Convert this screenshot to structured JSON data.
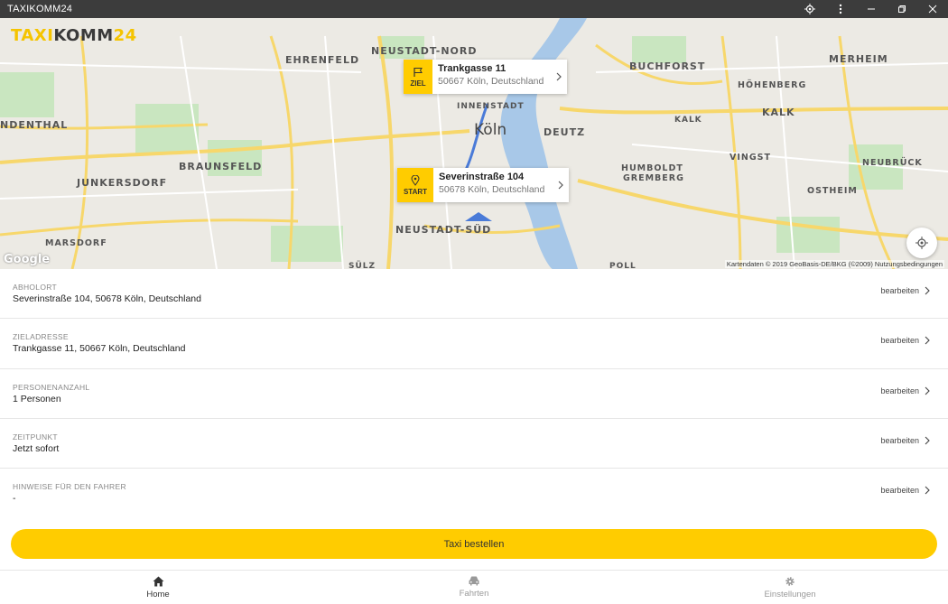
{
  "window": {
    "title": "TAXIKOMM24"
  },
  "logo": {
    "part1": "TAXI",
    "part2": "KOMM",
    "part3": "24"
  },
  "map": {
    "districts": [
      {
        "key": "neustadt_nord",
        "text": "NEUSTADT-NORD"
      },
      {
        "key": "ehrenfeld",
        "text": "EHRENFELD"
      },
      {
        "key": "buchforst",
        "text": "BUCHFORST"
      },
      {
        "key": "merheim",
        "text": "MERHEIM"
      },
      {
        "key": "hoehenberg",
        "text": "HÖHENBERG"
      },
      {
        "key": "kalk_small",
        "text": "KALK"
      },
      {
        "key": "kalk",
        "text": "KALK"
      },
      {
        "key": "innenstadt",
        "text": "INNENSTADT"
      },
      {
        "key": "deutz",
        "text": "DEUTZ"
      },
      {
        "key": "ndenthal",
        "text": "NDENTHAL"
      },
      {
        "key": "braunsfeld",
        "text": "BRAUNSFELD"
      },
      {
        "key": "junkersdorf",
        "text": "JUNKERSDORF"
      },
      {
        "key": "vingst",
        "text": "VINGST"
      },
      {
        "key": "neubrueck",
        "text": "NEUBRÜCK"
      },
      {
        "key": "humboldt",
        "text": "HUMBOLDT"
      },
      {
        "key": "gremberg",
        "text": "GREMBERG"
      },
      {
        "key": "ostheim",
        "text": "OSTHEIM"
      },
      {
        "key": "neustadt_sued",
        "text": "NEUSTADT-SÜD"
      },
      {
        "key": "marsdorf",
        "text": "MARSDORF"
      },
      {
        "key": "suelz",
        "text": "SÜLZ"
      },
      {
        "key": "poll",
        "text": "POLL"
      }
    ],
    "city": "Köln",
    "google": "Google",
    "attribution": "Kartendaten © 2019 GeoBasis-DE/BKG (©2009)   Nutzungsbedingungen",
    "destination_pin": {
      "badge": "ZIEL",
      "street": "Trankgasse 11",
      "city": "50667 Köln, Deutschland"
    },
    "start_pin": {
      "badge": "START",
      "street": "Severinstraße 104",
      "city": "50678 Köln, Deutschland"
    }
  },
  "details": [
    {
      "label": "ABHOLORT",
      "value": "Severinstraße 104, 50678 Köln, Deutschland",
      "action": "bearbeiten"
    },
    {
      "label": "ZIELADRESSE",
      "value": "Trankgasse 11, 50667 Köln, Deutschland",
      "action": "bearbeiten"
    },
    {
      "label": "PERSONENANZAHL",
      "value": "1 Personen",
      "action": "bearbeiten"
    },
    {
      "label": "ZEITPUNKT",
      "value": "Jetzt sofort",
      "action": "bearbeiten"
    },
    {
      "label": "HINWEISE FÜR DEN FAHRER",
      "value": "-",
      "action": "bearbeiten"
    }
  ],
  "order_button": "Taxi bestellen",
  "nav": [
    {
      "label": "Home",
      "icon": "home-icon",
      "active": true
    },
    {
      "label": "Fahrten",
      "icon": "car-icon",
      "active": false
    },
    {
      "label": "Einstellungen",
      "icon": "gear-icon",
      "active": false
    }
  ],
  "colors": {
    "accent": "#ffcc00",
    "titlebar": "#3c3c3c"
  }
}
